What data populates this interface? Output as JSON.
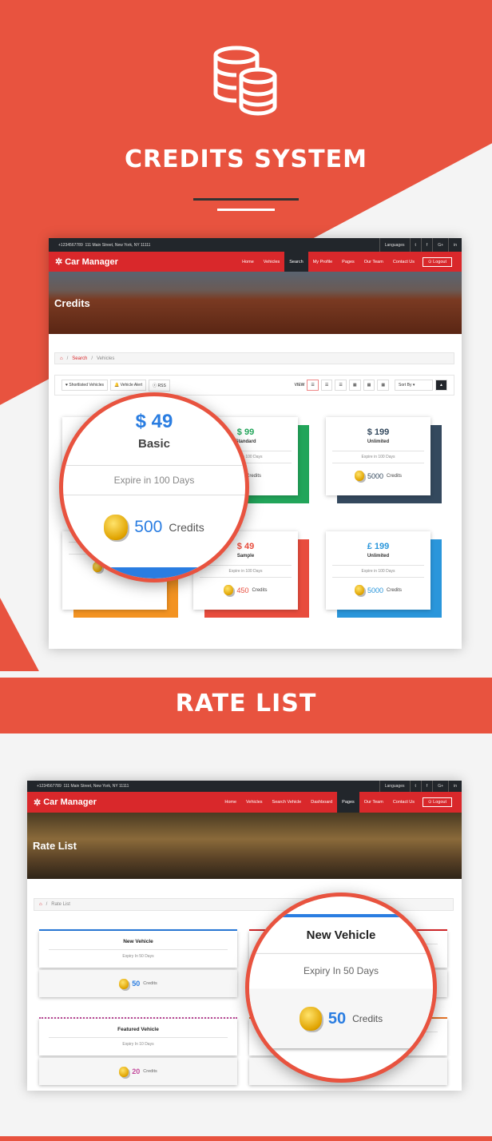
{
  "section1": {
    "title": "CREDITS SYSTEM",
    "icon": "database-icon"
  },
  "section2": {
    "title": "RATE LIST"
  },
  "colors": {
    "brand": "#e8533f",
    "nav": "#d9282b",
    "dark": "#22262b"
  },
  "topbar": {
    "phone": "+1234567789",
    "address": "111 Main Street, New York, NY 11111",
    "languages": "Languages",
    "social": [
      "twitter",
      "facebook",
      "G+",
      "in"
    ]
  },
  "shot1": {
    "logo": "Car Manager",
    "menu": [
      "Home",
      "Vehicles",
      "Search",
      "My Profile",
      "Pages",
      "Our Team",
      "Contact Us"
    ],
    "active": "Search",
    "logout": "Logout",
    "banner_title": "Credits",
    "breadcrumb": [
      "Search",
      "Vehicles"
    ],
    "toolbar": {
      "shortlisted": "Shortlisted Vehicles",
      "alert": "Vehicle Alert",
      "rss": "RSS",
      "view": "VIEW",
      "sort": "Sort By"
    },
    "cards": [
      {
        "price": "$ 49",
        "plan": "Basic",
        "expire": "Expire in 100 Days",
        "credits": "500",
        "credits_label": "Credits",
        "color": "#2a7de1"
      },
      {
        "price": "$ 99",
        "plan": "Standard",
        "expire": "Expire in 100 Days",
        "credits": "",
        "credits_label": "Credits",
        "color": "#22a55a"
      },
      {
        "price": "$ 199",
        "plan": "Unlimited",
        "expire": "Expire in 100 Days",
        "credits": "5000",
        "credits_label": "Credits",
        "color": "#34495e"
      },
      {
        "price": "",
        "plan": "",
        "expire": "Expire in",
        "credits": "250",
        "credits_label": "Credits",
        "color": "#f39322"
      },
      {
        "price": "$ 49",
        "plan": "Sample",
        "expire": "Expire in 100 Days",
        "credits": "450",
        "credits_label": "Credits",
        "color": "#e84c3d"
      },
      {
        "price": "£ 199",
        "plan": "Unlimited",
        "expire": "Expire in 100 Days",
        "credits": "5000",
        "credits_label": "Credits",
        "color": "#2a96db"
      }
    ],
    "magnifier": {
      "price": "$ 49",
      "plan": "Basic",
      "expire": "Expire in 100 Days",
      "credits": "500",
      "credits_label": "Credits"
    }
  },
  "shot2": {
    "logo": "Car Manager",
    "menu": [
      "Home",
      "Vehicles",
      "Search Vehicle",
      "Dashboard",
      "Pages",
      "Our Team",
      "Contact Us"
    ],
    "active": "Pages",
    "logout": "Logout",
    "banner_title": "Rate List",
    "breadcrumb": [
      "Rate List"
    ],
    "cards": [
      {
        "title": "New Vehicle",
        "expiry": "Expiry In 50 Days",
        "credits": "50",
        "credits_label": "Credits",
        "color": "#2a7de1"
      },
      {
        "title": "",
        "expiry": "",
        "credits": "",
        "credits_label": "",
        "color": "#d9282b"
      },
      {
        "title": "Featured Vehicle",
        "expiry": "Expiry In 10 Days",
        "credits": "20",
        "credits_label": "Credits",
        "color": "#c2499b"
      },
      {
        "title": "",
        "expiry": "",
        "credits": "",
        "credits_label": "",
        "color": "#f07b2c"
      }
    ],
    "magnifier": {
      "title": "New Vehicle",
      "expiry": "Expiry In 50 Days",
      "credits": "50",
      "credits_label": "Credits"
    }
  }
}
